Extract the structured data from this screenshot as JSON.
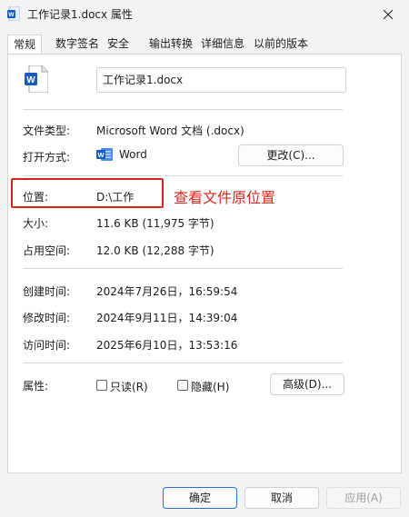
{
  "window": {
    "title": "工作记录1.docx 属性"
  },
  "tabs": [
    {
      "label": "常规"
    },
    {
      "label": "数字签名"
    },
    {
      "label": "安全"
    },
    {
      "label": "输出转换"
    },
    {
      "label": "详细信息"
    },
    {
      "label": "以前的版本"
    }
  ],
  "general": {
    "file_name": "工作记录1.docx",
    "file_type_label": "文件类型:",
    "file_type_value": "Microsoft Word 文档 (.docx)",
    "open_with_label": "打开方式:",
    "open_with_app": "Word",
    "change_button": "更改(C)...",
    "location_label": "位置:",
    "location_value": "D:\\工作",
    "size_label": "大小:",
    "size_value": "11.6 KB (11,975 字节)",
    "size_on_disk_label": "占用空间:",
    "size_on_disk_value": "12.0 KB (12,288 字节)",
    "created_label": "创建时间:",
    "created_value": "2024年7月26日，16:59:54",
    "modified_label": "修改时间:",
    "modified_value": "2024年9月11日，14:39:04",
    "accessed_label": "访问时间:",
    "accessed_value": "2025年6月10日，13:53:16",
    "attributes_label": "属性:",
    "readonly_label": "只读(R)",
    "hidden_label": "隐藏(H)",
    "advanced_button": "高级(D)..."
  },
  "annotation": {
    "text": "查看文件原位置",
    "color": "#d9261c"
  },
  "footer": {
    "ok": "确定",
    "cancel": "取消",
    "apply": "应用(A)"
  },
  "colors": {
    "word_blue": "#185abd",
    "accent": "#2a6fce"
  }
}
